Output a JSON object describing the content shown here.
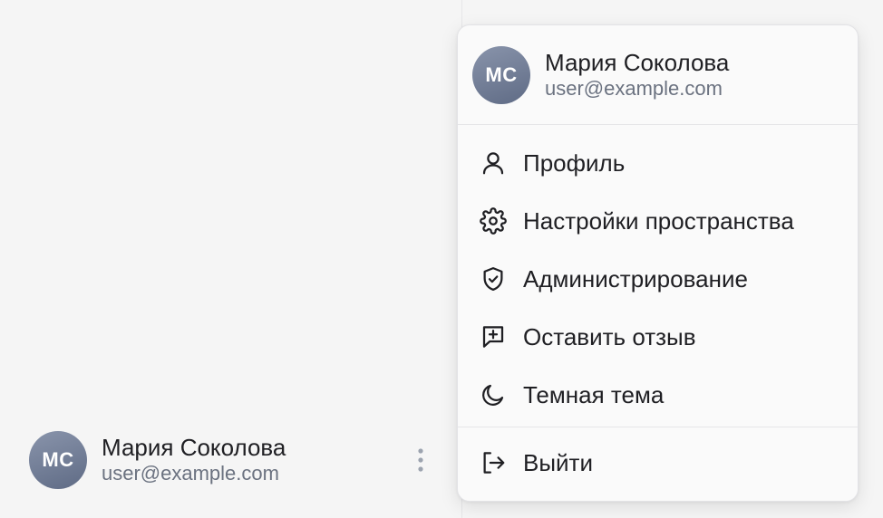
{
  "user": {
    "initials": "МС",
    "name": "Мария Соколова",
    "email": "user@example.com"
  },
  "menu": {
    "items": [
      {
        "label": "Профиль",
        "icon": "user-icon"
      },
      {
        "label": "Настройки пространства",
        "icon": "gear-icon"
      },
      {
        "label": "Администрирование",
        "icon": "shield-check-icon"
      },
      {
        "label": "Оставить отзыв",
        "icon": "message-plus-icon"
      },
      {
        "label": "Темная тема",
        "icon": "moon-icon"
      }
    ],
    "logout": {
      "label": "Выйти",
      "icon": "logout-icon"
    }
  },
  "colors": {
    "avatar_from": "#8994ab",
    "avatar_to": "#5f6b85",
    "text": "#1f1f23",
    "muted": "#6b7280"
  }
}
